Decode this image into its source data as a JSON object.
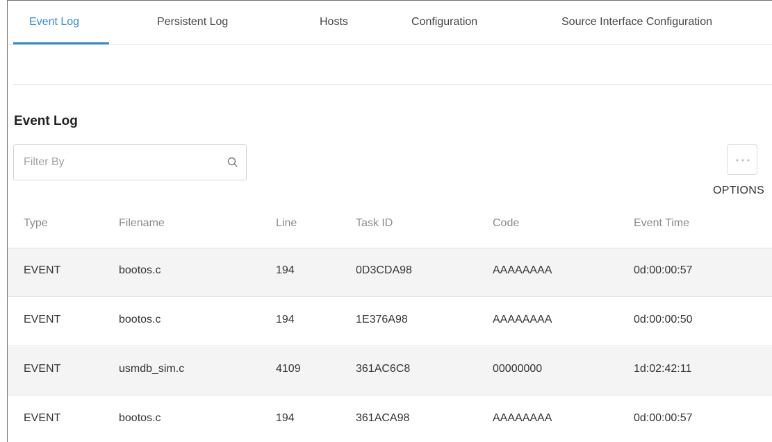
{
  "tabs": [
    {
      "label": "Event Log",
      "active": true
    },
    {
      "label": "Persistent Log",
      "active": false
    },
    {
      "label": "Hosts",
      "active": false
    },
    {
      "label": "Configuration",
      "active": false
    },
    {
      "label": "Source Interface Configuration",
      "active": false
    }
  ],
  "section": {
    "title": "Event Log"
  },
  "filter": {
    "placeholder": "Filter By",
    "value": "",
    "icon": "search-icon"
  },
  "options": {
    "label": "OPTIONS",
    "icon": "ellipsis-icon"
  },
  "table": {
    "columns": [
      "Type",
      "Filename",
      "Line",
      "Task ID",
      "Code",
      "Event Time"
    ],
    "rows": [
      [
        "EVENT",
        "bootos.c",
        "194",
        "0D3CDA98",
        "AAAAAAAA",
        "0d:00:00:57"
      ],
      [
        "EVENT",
        "bootos.c",
        "194",
        "1E376A98",
        "AAAAAAAA",
        "0d:00:00:50"
      ],
      [
        "EVENT",
        "usmdb_sim.c",
        "4109",
        "361AC6C8",
        "00000000",
        "1d:02:42:11"
      ],
      [
        "EVENT",
        "bootos.c",
        "194",
        "361ACA98",
        "AAAAAAAA",
        "0d:00:00:57"
      ]
    ]
  },
  "colors": {
    "accent": "#2e8bd6",
    "row_shade": "#f4f4f4",
    "header_text": "#8a8a8a",
    "body_text": "#333333"
  }
}
